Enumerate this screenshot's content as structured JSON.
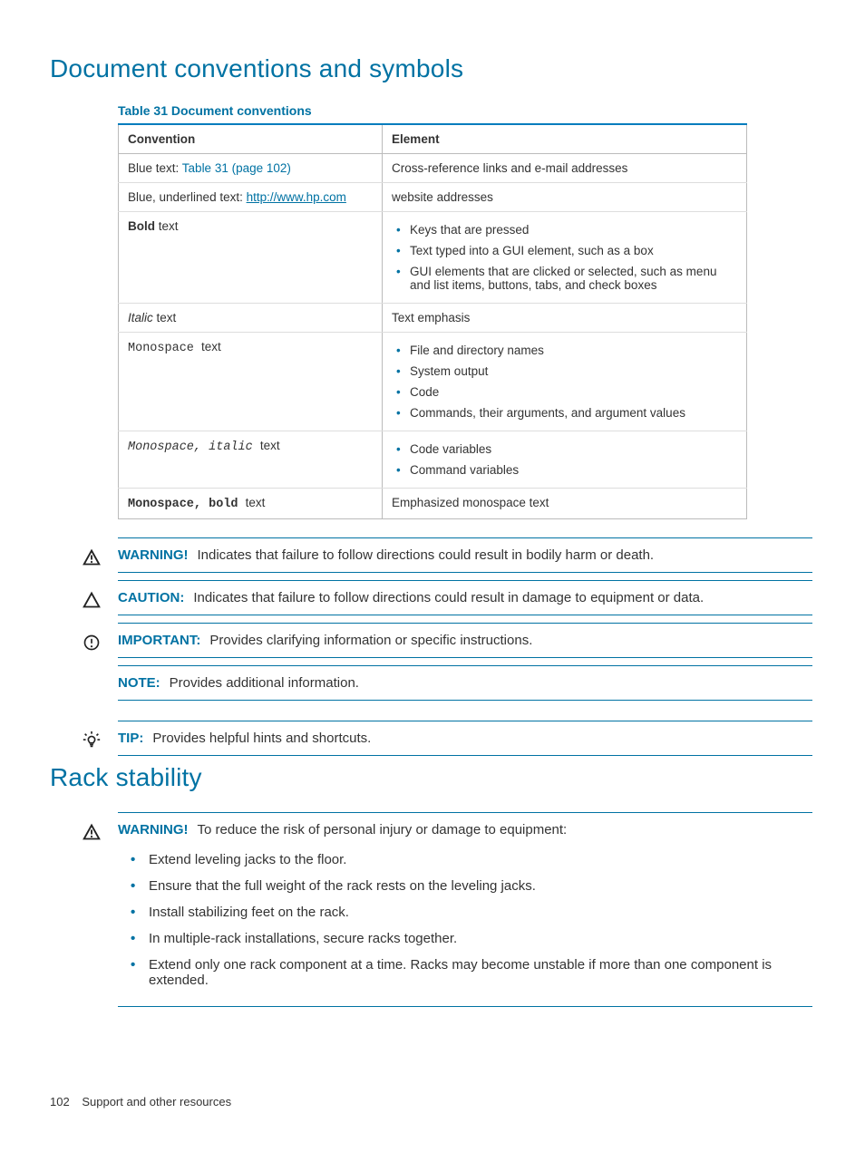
{
  "heading1": "Document conventions and symbols",
  "table_caption": "Table 31 Document conventions",
  "columns": {
    "c1": "Convention",
    "c2": "Element"
  },
  "rows": {
    "r1c1_prefix": "Blue text: ",
    "r1c1_link": "Table 31 (page 102)",
    "r1c2": "Cross-reference links and e-mail addresses",
    "r2c1_prefix": "Blue, underlined text: ",
    "r2c1_link": "http://www.hp.com",
    "r2c2": "website addresses",
    "r3c1_bold": "Bold",
    "r3c1_suffix": " text",
    "r3c2_items": {
      "a": "Keys that are pressed",
      "b": "Text typed into a GUI element, such as a box",
      "c": "GUI elements that are clicked or selected, such as menu and list items, buttons, tabs, and check boxes"
    },
    "r4c1_italic": "Italic ",
    "r4c1_suffix": " text",
    "r4c2": "Text emphasis",
    "r5c1_mono": "Monospace ",
    "r5c1_suffix": " text",
    "r5c2_items": {
      "a": "File and directory names",
      "b": "System output",
      "c": "Code",
      "d": "Commands, their arguments, and argument values"
    },
    "r6c1_mono_it": "Monospace, italic ",
    "r6c1_suffix": " text",
    "r6c2_items": {
      "a": "Code variables",
      "b": "Command variables"
    },
    "r7c1_mono_bold": "Monospace, bold ",
    "r7c1_suffix": " text",
    "r7c2": "Emphasized monospace text"
  },
  "adm": {
    "warning_label": "WARNING!",
    "warning_text": "Indicates that failure to follow directions could result in bodily harm or death.",
    "caution_label": "CAUTION:",
    "caution_text": "Indicates that failure to follow directions could result in damage to equipment or data.",
    "important_label": "IMPORTANT:",
    "important_text": "Provides clarifying information or specific instructions.",
    "note_label": "NOTE:",
    "note_text": "Provides additional information.",
    "tip_label": "TIP:",
    "tip_text": "Provides helpful hints and shortcuts."
  },
  "heading2": "Rack stability",
  "rack": {
    "warning_label": "WARNING!",
    "warning_text": "To reduce the risk of personal injury or damage to equipment:",
    "items": {
      "a": "Extend leveling jacks to the floor.",
      "b": "Ensure that the full weight of the rack rests on the leveling jacks.",
      "c": "Install stabilizing feet on the rack.",
      "d": "In multiple-rack installations, secure racks together.",
      "e": "Extend only one rack component at a time. Racks may become unstable if more than one component is extended."
    }
  },
  "footer": {
    "page": "102",
    "section": "Support and other resources"
  }
}
